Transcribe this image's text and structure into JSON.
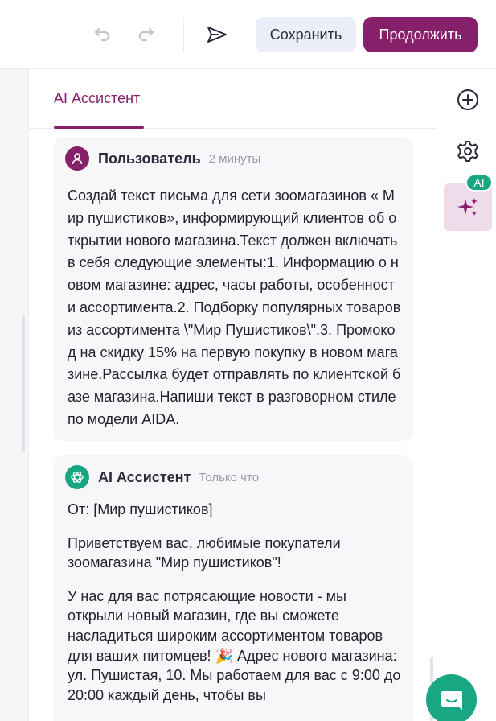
{
  "toolbar": {
    "undo_icon": "undo-icon",
    "redo_icon": "redo-icon",
    "send_icon": "send-icon",
    "save_label": "Сохранить",
    "continue_label": "Продолжить"
  },
  "tabs": [
    {
      "label": "AI Ассистент",
      "active": true
    }
  ],
  "messages": [
    {
      "author": "Пользователь",
      "time": "2 минуты",
      "text": "Создай текст письма для сети зоомагазинов « Мир пушистиков», информирующий клиентов об открытии нового магазина.Текст должен включать в себя следующие элементы:1. Информацию о новом магазине: адрес, часы работы, особенности ассортимента.2. Подборку популярных товаров из ассортимента \\\"Мир Пушистиков\\\".3. Промокод на скидку 15% на первую покупку в новом магазине.Рассылка будет отправлять по клиентской базе магазина.Напиши текст в разговорном стиле по модели AIDA."
    },
    {
      "author": "AI Ассистент",
      "time": "Только что",
      "paragraphs": [
        "От: [Мир пушистиков]",
        "Приветствуем вас, любимые покупатели зоомагазина \"Мир пушистиков\"!",
        "У нас для вас потрясающие новости - мы открыли новый магазин, где вы сможете насладиться широким ассортиментом товаров для ваших питомцев! 🎉 Адрес нового магазина: ул. Пушистая, 10. Мы работаем для вас с 9:00 до 20:00 каждый день, чтобы вы"
      ]
    }
  ],
  "rail": {
    "add_icon": "plus-circle-icon",
    "settings_icon": "gear-icon",
    "ai_icon": "sparkles-icon",
    "ai_badge": "AI"
  },
  "colors": {
    "brand": "#87206b",
    "accent": "#19a683",
    "save_bg": "#eceef8"
  }
}
